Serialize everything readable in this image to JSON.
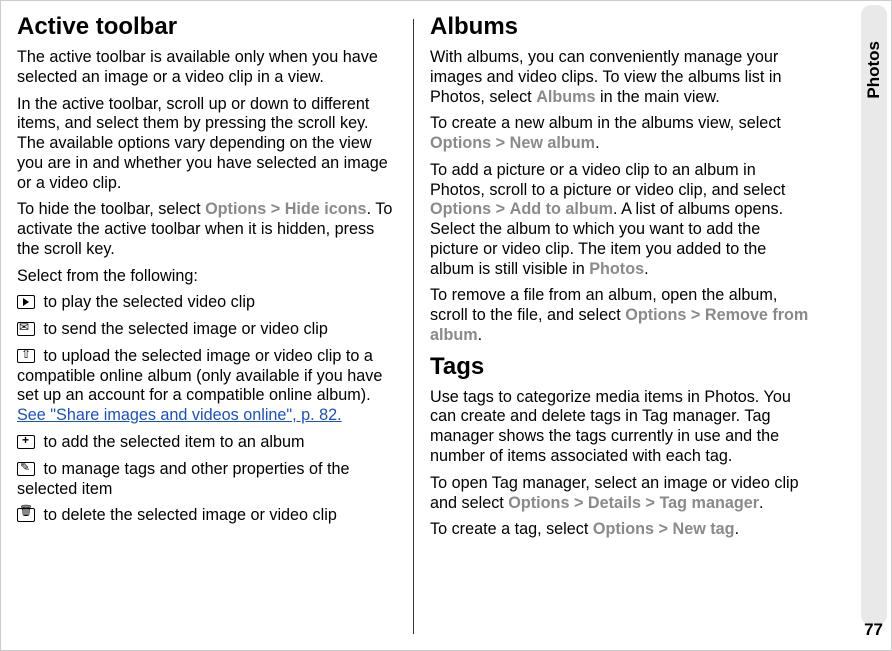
{
  "side": {
    "label": "Photos"
  },
  "page_number": "77",
  "left": {
    "h": "Active toolbar",
    "p1": "The active toolbar is available only when you have selected an image or a video clip in a view.",
    "p2": "In the active toolbar, scroll up or down to different items, and select them by pressing the scroll key. The available options vary depending on the view you are in and whether you have selected an image or a video clip.",
    "p3a": "To hide the toolbar, select ",
    "p3o": "Options",
    "gt1": ">",
    "p3b": "Hide icons",
    "p3c": ". To activate the active toolbar when it is hidden, press the scroll key.",
    "p4": "Select from the following:",
    "i1": "  to play the selected video clip",
    "i2": "  to send the selected image or video clip",
    "i3a": "  to upload the selected image or video clip to a compatible online album (only available if you have set up an account for a compatible online album). ",
    "i3link": "See \"Share images and videos online\", p. 82.",
    "i4": "  to add the selected item to an album",
    "i5": "  to manage tags and other properties of the selected item",
    "i6": "  to delete the selected image or video clip"
  },
  "right": {
    "h1": "Albums",
    "a1a": "With albums, you can conveniently manage your images and video clips. To view the albums list in Photos, select ",
    "a1b": "Albums",
    "a1c": " in the main view.",
    "a2a": "To create a new album in the albums view, select ",
    "a2o": "Options",
    "gt": ">",
    "a2b": "New album",
    "a2c": ".",
    "a3a": "To add a picture or a video clip to an album in Photos, scroll to a picture or video clip, and select ",
    "a3o": "Options",
    "a3b": "Add to album",
    "a3c": ". A list of albums opens. Select the album to which you want to add the picture or video clip. The item you added to the album is still visible in ",
    "a3d": "Photos",
    "a3e": ".",
    "a4a": "To remove a file from an album, open the album, scroll to the file, and select ",
    "a4o": "Options",
    "a4b": "Remove from album",
    "a4c": ".",
    "h2": "Tags",
    "t1": "Use tags to categorize media items in Photos. You can create and delete tags in Tag manager. Tag manager shows the tags currently in use and the number of items associated with each tag.",
    "t2a": "To open Tag manager, select an image or video clip and select ",
    "t2o": "Options",
    "t2b": "Details",
    "t2c": "Tag manager",
    "t2d": ".",
    "t3a": "To create a tag, select ",
    "t3o": "Options",
    "t3b": "New tag",
    "t3c": "."
  }
}
